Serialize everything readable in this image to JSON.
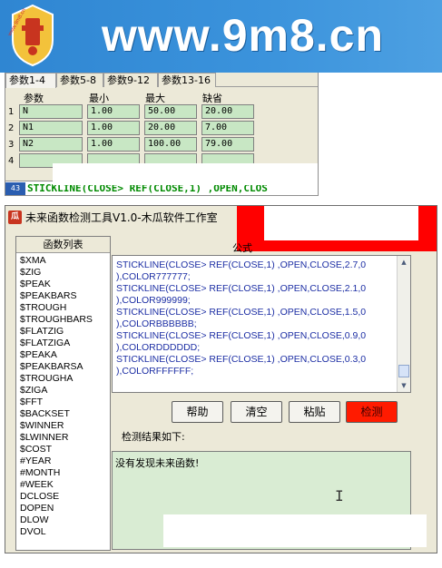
{
  "banner": {
    "url_text": "www.9m8.cn",
    "logo_text": "www.9m8.cn",
    "colors": {
      "background": "#3b93dc",
      "logo_red": "#c8341f",
      "logo_gold": "#f3c23b"
    }
  },
  "params": {
    "tabs": [
      "参数1-4",
      "参数5-8",
      "参数9-12",
      "参数13-16"
    ],
    "headers": [
      "参数",
      "最小",
      "最大",
      "缺省"
    ],
    "rows": [
      {
        "num": "1",
        "name": "N",
        "min": "1.00",
        "max": "50.00",
        "default": "20.00"
      },
      {
        "num": "2",
        "name": "N1",
        "min": "1.00",
        "max": "20.00",
        "default": "7.00"
      },
      {
        "num": "3",
        "name": "N2",
        "min": "1.00",
        "max": "100.00",
        "default": "79.00"
      },
      {
        "num": "4",
        "name": "",
        "min": "",
        "max": "",
        "default": ""
      }
    ],
    "formula_marker": "43",
    "formula_line": "STICKLINE(CLOSE> REF(CLOSE,1) ,OPEN,CLOS"
  },
  "window": {
    "icon_glyph": "瓜",
    "title": "未来函数检测工具V1.0-木瓜软件工作室",
    "function_list_header": "函数列表",
    "functions": [
      "$XMA",
      "$ZIG",
      "$PEAK",
      "$PEAKBARS",
      "$TROUGH",
      "$TROUGHBARS",
      "$FLATZIG",
      "$FLATZIGA",
      "$PEAKA",
      "$PEAKBARSA",
      "$TROUGHA",
      "$ZIGA",
      "$FFT",
      "$BACKSET",
      "$WINNER",
      "$LWINNER",
      "$COST",
      "#YEAR",
      "#MONTH",
      "#WEEK",
      "DCLOSE",
      "DOPEN",
      "DLOW",
      "DVOL"
    ],
    "formula_label": "公式",
    "formula_text": "STICKLINE(CLOSE> REF(CLOSE,1) ,OPEN,CLOSE,2.7,0\n),COLOR777777;\nSTICKLINE(CLOSE> REF(CLOSE,1) ,OPEN,CLOSE,2.1,0\n),COLOR999999;\nSTICKLINE(CLOSE> REF(CLOSE,1) ,OPEN,CLOSE,1.5,0\n),COLORBBBBBB;\nSTICKLINE(CLOSE> REF(CLOSE,1) ,OPEN,CLOSE,0.9,0\n),COLORDDDDDD;\nSTICKLINE(CLOSE> REF(CLOSE,1) ,OPEN,CLOSE,0.3,0\n),COLORFFFFFF;",
    "buttons": {
      "help": "帮助",
      "clear": "清空",
      "paste": "粘贴",
      "detect": "检测"
    },
    "result_label": "检测结果如下:",
    "result_text": "没有发现未来函数!",
    "cursor_glyph": "I"
  }
}
